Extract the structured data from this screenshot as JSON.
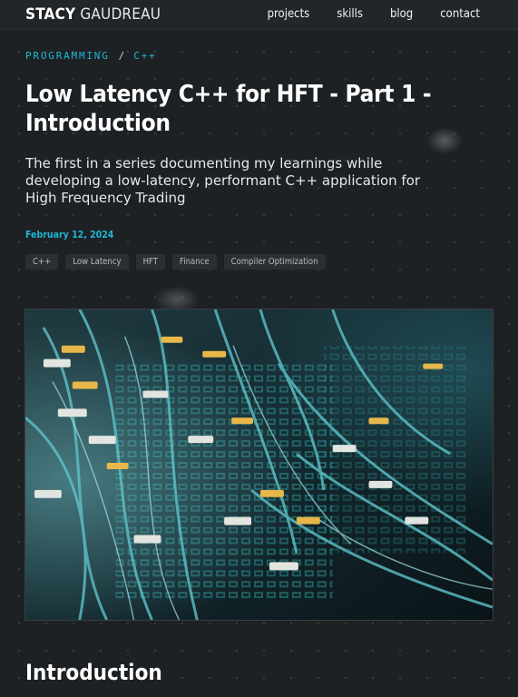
{
  "header": {
    "brand_first": "STACY",
    "brand_last": "GAUDREAU",
    "nav": [
      "projects",
      "skills",
      "blog",
      "contact"
    ]
  },
  "breadcrumb": {
    "category": "PROGRAMMING",
    "separator": "/",
    "subcategory": "C++"
  },
  "article": {
    "title": "Low Latency C++ for HFT - Part 1 - Introduction",
    "subtitle": "The first in a series documenting my learnings while developing a low-latency, performant C++ application for High Frequency Trading",
    "date": "February 12, 2024",
    "tags": [
      "C++",
      "Low Latency",
      "HFT",
      "Finance",
      "Compiler Optimization"
    ],
    "hero_image_subject": "network-patch-panel-fiber-cables-photo",
    "first_section_heading": "Introduction"
  },
  "colors": {
    "background": "#1d2124",
    "accent": "#1fb7d4",
    "tag_background": "#2b2f33"
  }
}
